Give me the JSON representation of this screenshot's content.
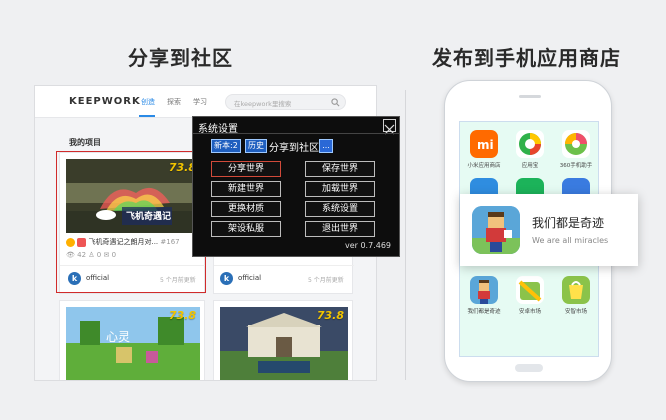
{
  "headings": {
    "left": "分享到社区",
    "right": "发布到手机应用商店"
  },
  "site": {
    "logo": "KEEPWORK",
    "nav": [
      "创造",
      "探索",
      "学习"
    ],
    "search_placeholder": "在keepwork里搜索",
    "section_title": "我的项目",
    "cards": [
      {
        "badge": "73.8",
        "title": "飞机奇遇记之朗月对...",
        "id": "#167",
        "stats": "42",
        "stats2": "0",
        "stats3": "0",
        "user": "official",
        "time": "5 个月前更新"
      },
      {
        "badge": "",
        "title": "",
        "id": "",
        "user": "official",
        "time": "5 个月前更新"
      },
      {
        "badge": "73.8",
        "title": "",
        "user": "",
        "time": ""
      },
      {
        "badge": "73.8",
        "title": "",
        "user": "",
        "time": ""
      }
    ]
  },
  "dialog": {
    "title": "系统设置",
    "tabs": [
      "新本:2",
      "历史"
    ],
    "tab_text": "分享到社区",
    "tab_more": "...",
    "buttons": [
      "分享世界",
      "保存世界",
      "新建世界",
      "加载世界",
      "更换材质",
      "系统设置",
      "架设私服",
      "退出世界"
    ],
    "version": "ver 0.7.469"
  },
  "phone": {
    "apps": [
      {
        "label": "小米应用商店",
        "color": "#ff6a00"
      },
      {
        "label": "应用宝",
        "color": "#ffffff"
      },
      {
        "label": "360手机助手",
        "color": "#ffffff"
      },
      {
        "label": "",
        "color": "#2f8de0"
      },
      {
        "label": "",
        "color": "#1cb35a"
      },
      {
        "label": "",
        "color": "#3a7be0"
      },
      {
        "label": "我们都是奇迹",
        "color": "#5aa6d8"
      },
      {
        "label": "安卓市场",
        "color": "#ffffff"
      },
      {
        "label": "安智市场",
        "color": "#8bc34a"
      }
    ],
    "popup": {
      "title": "我们都是奇迹",
      "subtitle": "We are all miracles"
    }
  }
}
